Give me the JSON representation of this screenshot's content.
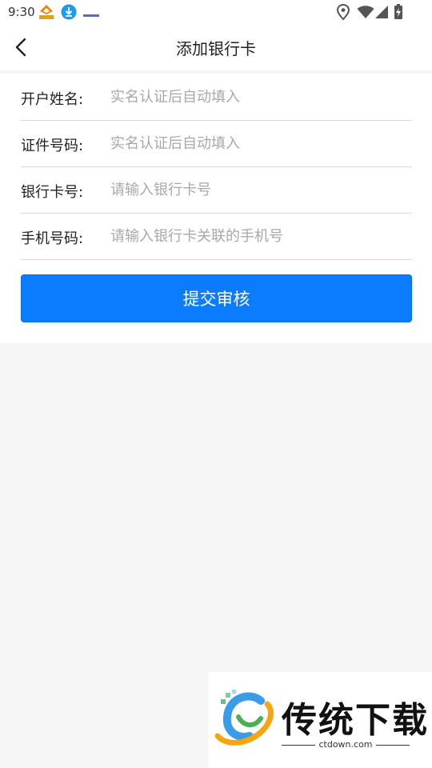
{
  "status_bar": {
    "time": "9:30",
    "notification_icons": [
      "app-notification-icon",
      "download-icon",
      "small-logo-icon"
    ],
    "system_icons": [
      "location-icon",
      "wifi-icon",
      "signal-icon",
      "battery-icon"
    ]
  },
  "header": {
    "title": "添加银行卡",
    "back_icon": "chevron-left-icon"
  },
  "form": {
    "fields": [
      {
        "label": "开户姓名:",
        "placeholder": "实名认证后自动填入",
        "value": ""
      },
      {
        "label": "证件号码:",
        "placeholder": "实名认证后自动填入",
        "value": ""
      },
      {
        "label": "银行卡号:",
        "placeholder": "请输入银行卡号",
        "value": ""
      },
      {
        "label": "手机号码:",
        "placeholder": "请输入银行卡关联的手机号",
        "value": ""
      }
    ],
    "submit_label": "提交审核"
  },
  "watermark": {
    "brand": "传统下载",
    "domain": "ctdown.com"
  },
  "colors": {
    "accent": "#0a7cff",
    "background": "#f5f5f5",
    "surface": "#ffffff",
    "placeholder": "#a8a8a8"
  }
}
